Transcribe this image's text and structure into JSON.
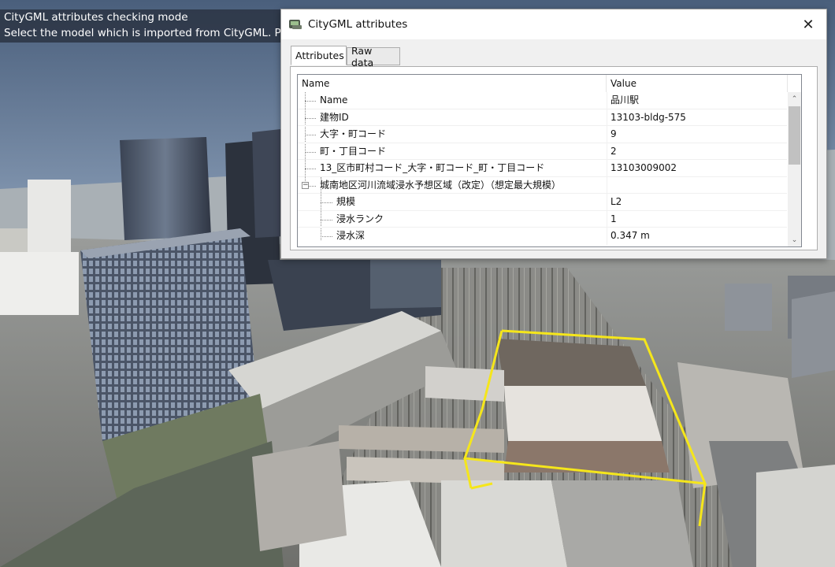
{
  "overlay": {
    "line1": "CityGML attributes checking mode",
    "line2": "Select the model which is imported from CityGML. P"
  },
  "dialog": {
    "title": "CityGML attributes",
    "close_symbol": "✕",
    "icon": "citygml-app-icon"
  },
  "tabs": [
    {
      "label": "Attributes",
      "selected": true
    },
    {
      "label": "Raw data",
      "selected": false
    }
  ],
  "table": {
    "columns": [
      "Name",
      "Value"
    ],
    "rows": [
      {
        "name": "Name",
        "value": "品川駅"
      },
      {
        "name": "建物ID",
        "value": "13103-bldg-575"
      },
      {
        "name": "大字・町コード",
        "value": "9"
      },
      {
        "name": "町・丁目コード",
        "value": "2"
      },
      {
        "name": "13_区市町村コード_大字・町コード_町・丁目コード",
        "value": "13103009002"
      },
      {
        "name": "城南地区河川流域浸水予想区域（改定）（想定最大規模）",
        "value": "",
        "expanded": true
      },
      {
        "name": "規模",
        "value": "L2"
      },
      {
        "name": "浸水ランク",
        "value": "1"
      },
      {
        "name": "浸水深",
        "value": "0.347 m"
      }
    ]
  },
  "scrollbar": {
    "up_arrow": "⌃",
    "down_arrow": "⌄"
  },
  "colors": {
    "selection_box": "#f5e61b",
    "overlay_bg": "#28303e"
  }
}
